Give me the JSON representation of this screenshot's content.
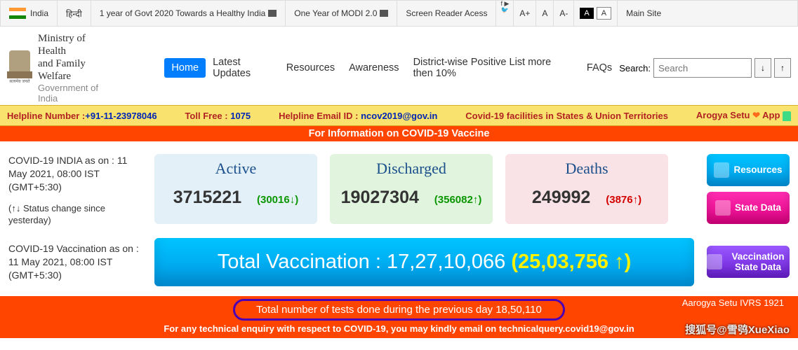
{
  "topbar": {
    "country": "India",
    "hindi": "हिन्दी",
    "link1": "1 year of Govt 2020 Towards a Healthy India",
    "link2": "One Year of MODI 2.0",
    "screen_reader": "Screen Reader Acess",
    "a_plus": "A+",
    "a_norm": "A",
    "a_minus": "A-",
    "theme_a": "A",
    "theme_a2": "A",
    "main_site": "Main Site"
  },
  "ministry": {
    "line1": "Ministry of Health",
    "line2": "and Family Welfare",
    "sub": "Government of India",
    "script": "सत्यमेव जयते"
  },
  "nav": {
    "home": "Home",
    "latest": "Latest Updates",
    "resources": "Resources",
    "awareness": "Awareness",
    "district": "District-wise Positive List more then 10%",
    "faqs": "FAQs"
  },
  "search": {
    "label": "Search:",
    "placeholder": "Search",
    "down": "↓",
    "up": "↑"
  },
  "helpline": {
    "number_label": "Helpline Number :",
    "number": "+91-11-23978046",
    "toll_label": "Toll Free :",
    "toll": " 1075",
    "email_label": "Helpline Email ID :",
    "email": " ncov2019@gov.in",
    "facilities": "Covid-19 facilities in States & Union Territories",
    "arogya_label": "Arogya Setu ",
    "arogya_app": " App "
  },
  "info_bar": "For Information on COVID-19 Vaccine",
  "stats": {
    "as_on": "COVID-19 INDIA as on : 11 May 2021, 08:00 IST (GMT+5:30)",
    "status_change": "(↑↓ Status change since yesterday)",
    "active_label": "Active",
    "active_num": "3715221",
    "active_delta": "(30016↓)",
    "discharged_label": "Discharged",
    "discharged_num": "19027304",
    "discharged_delta": "(356082↑)",
    "deaths_label": "Deaths",
    "deaths_num": "249992",
    "deaths_delta": "(3876↑)"
  },
  "vaccination": {
    "as_on": "COVID-19 Vaccination as on : 11 May 2021, 08:00 IST (GMT+5:30)",
    "label": "Total Vaccination : ",
    "value": "17,27,10,066",
    "delta": "(25,03,756 ↑)"
  },
  "side": {
    "resources": "Resources",
    "state_data": "State Data",
    "vacc_state": "Vaccination State Data"
  },
  "footer": {
    "tests": "Total number of tests done during the previous day 18,50,110",
    "tech": "For any technical enquiry with respect to COVID-19, you may kindly email on technicalquery.covid19@gov.in",
    "arogya": "Aarogya Setu IVRS   1921",
    "watermark": "搜狐号@雪鸮XueXiao"
  }
}
